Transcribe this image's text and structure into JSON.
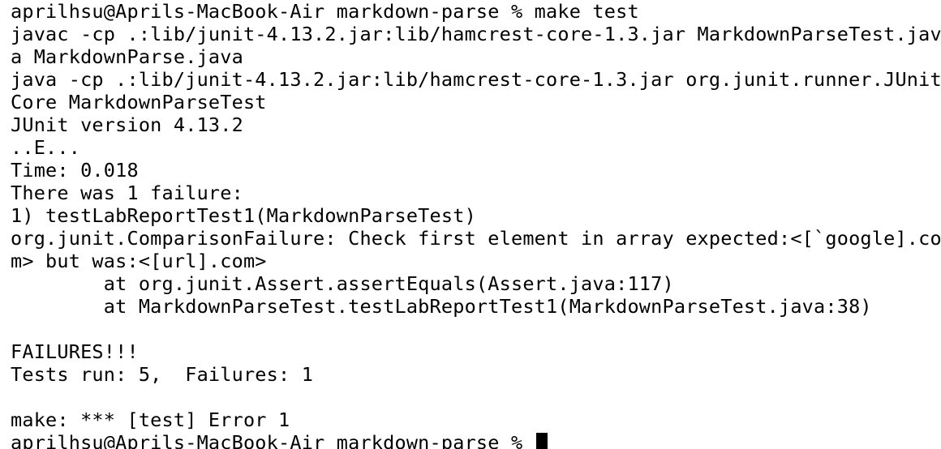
{
  "terminal": {
    "lines": [
      "aprilhsu@Aprils-MacBook-Air markdown-parse % make test",
      "javac -cp .:lib/junit-4.13.2.jar:lib/hamcrest-core-1.3.jar MarkdownParseTest.jav",
      "a MarkdownParse.java",
      "java -cp .:lib/junit-4.13.2.jar:lib/hamcrest-core-1.3.jar org.junit.runner.JUnit",
      "Core MarkdownParseTest",
      "JUnit version 4.13.2",
      "..E...",
      "Time: 0.018",
      "There was 1 failure:",
      "1) testLabReportTest1(MarkdownParseTest)",
      "org.junit.ComparisonFailure: Check first element in array expected:<[`google].co",
      "m> but was:<[url].com>",
      "        at org.junit.Assert.assertEquals(Assert.java:117)",
      "        at MarkdownParseTest.testLabReportTest1(MarkdownParseTest.java:38)",
      "",
      "FAILURES!!!",
      "Tests run: 5,  Failures: 1",
      "",
      "make: *** [test] Error 1"
    ],
    "prompt": "aprilhsu@Aprils-MacBook-Air markdown-parse % "
  }
}
